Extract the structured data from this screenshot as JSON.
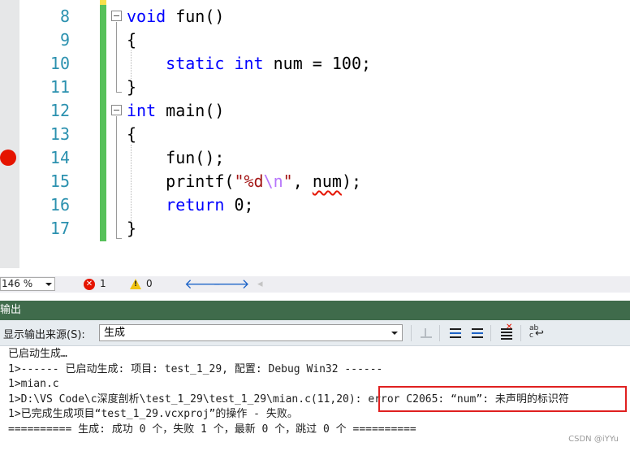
{
  "editor": {
    "line_numbers": [
      "8",
      "9",
      "10",
      "11",
      "12",
      "13",
      "14",
      "15",
      "16",
      "17"
    ],
    "lines": [
      {
        "num": "8",
        "parts": [
          {
            "t": "void",
            "c": "kw"
          },
          {
            "t": " fun()",
            "c": ""
          }
        ]
      },
      {
        "num": "9",
        "parts": [
          {
            "t": "{",
            "c": ""
          }
        ]
      },
      {
        "num": "10",
        "parts": [
          {
            "t": "    ",
            "c": ""
          },
          {
            "t": "static",
            "c": "kw"
          },
          {
            "t": " ",
            "c": ""
          },
          {
            "t": "int",
            "c": "kw"
          },
          {
            "t": " num = 100;",
            "c": ""
          }
        ]
      },
      {
        "num": "11",
        "parts": [
          {
            "t": "}",
            "c": ""
          }
        ]
      },
      {
        "num": "12",
        "parts": [
          {
            "t": "int",
            "c": "kw"
          },
          {
            "t": " main()",
            "c": ""
          }
        ]
      },
      {
        "num": "13",
        "parts": [
          {
            "t": "{",
            "c": ""
          }
        ]
      },
      {
        "num": "14",
        "parts": [
          {
            "t": "    fun();",
            "c": ""
          }
        ]
      },
      {
        "num": "15",
        "parts": [
          {
            "t": "    printf(",
            "c": ""
          },
          {
            "t": "\"%d",
            "c": "str"
          },
          {
            "t": "\\n",
            "c": "esc"
          },
          {
            "t": "\"",
            "c": "str"
          },
          {
            "t": ", ",
            "c": ""
          },
          {
            "t": "num",
            "c": "err"
          },
          {
            "t": ");",
            "c": ""
          }
        ]
      },
      {
        "num": "16",
        "parts": [
          {
            "t": "    ",
            "c": ""
          },
          {
            "t": "return",
            "c": "kw"
          },
          {
            "t": " 0;",
            "c": ""
          }
        ]
      },
      {
        "num": "17",
        "parts": [
          {
            "t": "}",
            "c": ""
          }
        ]
      }
    ],
    "breakpoint_line": "14"
  },
  "statusbar": {
    "zoom": "146 %",
    "error_count": "1",
    "warning_count": "0",
    "icons": [
      "error-icon",
      "warning-icon",
      "navigate-back-icon",
      "navigate-forward-icon",
      "filter-icon"
    ]
  },
  "output": {
    "title": "输出",
    "source_label": "显示输出来源(S):",
    "source_value": "生成",
    "lines": [
      "已启动生成…",
      "1>------ 已启动生成: 项目: test_1_29, 配置: Debug Win32 ------",
      "1>mian.c",
      "1>D:\\VS Code\\c深度剖析\\test_1_29\\test_1_29\\mian.c(11,20): error C2065: “num”: 未声明的标识符",
      "1>已完成生成项目“test_1_29.vcxproj”的操作 - 失败。",
      "========== 生成: 成功 0 个，失败 1 个，最新 0 个，跳过 0 个 =========="
    ]
  },
  "watermark": "CSDN @iYYu"
}
